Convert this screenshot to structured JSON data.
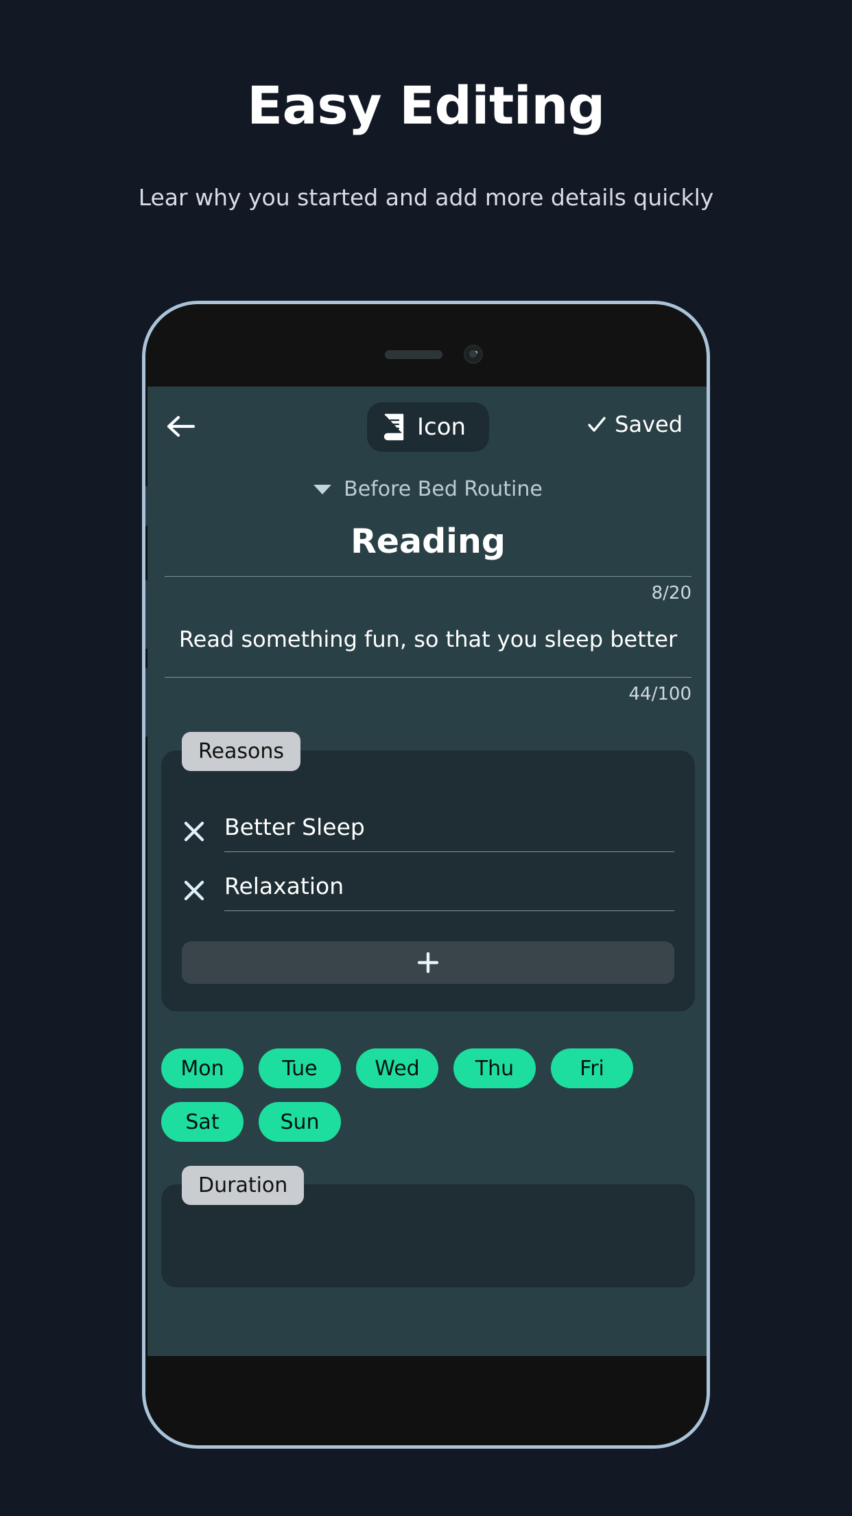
{
  "promo": {
    "title": "Easy Editing",
    "subtitle": "Lear why you started and add more details quickly"
  },
  "colors": {
    "page_background": "#121824",
    "screen_background": "#2a4047",
    "card_background": "#1f2e34",
    "accent_green": "#1ede9f",
    "label_pill": "#c9ccd0",
    "phone_frame": "#aac3d8"
  },
  "app": {
    "header": {
      "back_icon": "arrow-left-icon",
      "icon_pill": {
        "icon": "book-icon",
        "label": "Icon"
      },
      "saved": {
        "icon": "check-icon",
        "label": "Saved"
      }
    },
    "routine": {
      "caret_icon": "caret-down-icon",
      "name": "Before Bed Routine"
    },
    "habit": {
      "title": "Reading",
      "title_counter": "8/20",
      "description": "Read something fun, so that you sleep better",
      "description_counter": "44/100"
    },
    "reasons": {
      "label": "Reasons",
      "items": [
        {
          "remove_icon": "close-icon",
          "text": "Better Sleep"
        },
        {
          "remove_icon": "close-icon",
          "text": "Relaxation"
        }
      ],
      "add_button": {
        "icon": "plus-icon",
        "label": ""
      }
    },
    "days": [
      {
        "label": "Mon",
        "selected": true
      },
      {
        "label": "Tue",
        "selected": true
      },
      {
        "label": "Wed",
        "selected": true
      },
      {
        "label": "Thu",
        "selected": true
      },
      {
        "label": "Fri",
        "selected": true
      },
      {
        "label": "Sat",
        "selected": true
      },
      {
        "label": "Sun",
        "selected": true
      }
    ],
    "duration": {
      "label": "Duration"
    }
  },
  "phone_hardware": {
    "speaker": "speaker-grille",
    "camera": "front-camera",
    "buttons": [
      "silent-switch",
      "volume-up-button",
      "volume-down-button",
      "power-button"
    ]
  }
}
